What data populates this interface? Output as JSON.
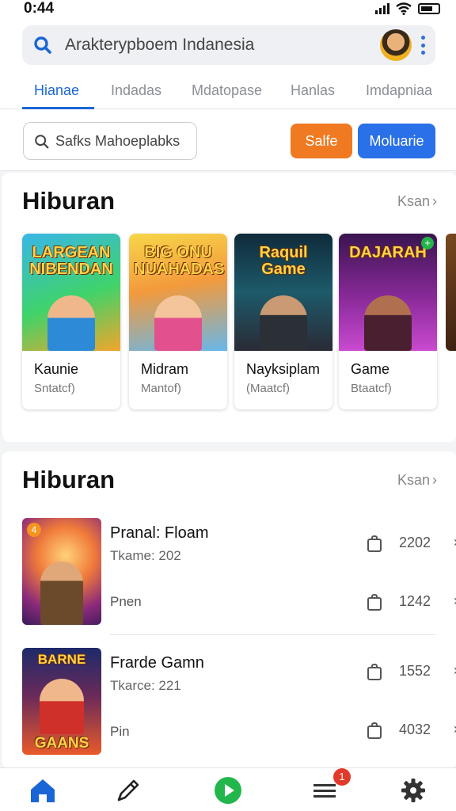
{
  "status_bar": {
    "time": "0:44"
  },
  "search": {
    "text": "Arakterypboem Indanesia"
  },
  "tabs": [
    {
      "label": "Hianae",
      "active": true
    },
    {
      "label": "Indadas",
      "active": false
    },
    {
      "label": "Mdatopase",
      "active": false
    },
    {
      "label": "Hanlas",
      "active": false
    },
    {
      "label": "Imdapniaa",
      "active": false
    }
  ],
  "filter": {
    "placeholder": "Safks Mahoeplabks",
    "orange_button": "Salfe",
    "blue_button": "Moluarie"
  },
  "colors": {
    "accent_blue": "#1a66d6",
    "orange": "#f07a22",
    "button_blue": "#2a70e8",
    "badge_red": "#e23a2a"
  },
  "section1": {
    "title": "Hiburan",
    "see_all": "Ksan",
    "cards": [
      {
        "art_title": "LARGEAN NIBENDAN",
        "name": "Kaunie",
        "sub": "Sntatcf)"
      },
      {
        "art_title": "BIG ONU NUAHADAS",
        "name": "Midram",
        "sub": "Mantof)"
      },
      {
        "art_title": "Raquil Game",
        "name": "Nayksiplam",
        "sub": "(Maatcf)"
      },
      {
        "art_title": "DAJARAH",
        "name": "Game",
        "sub": "Btaatcf)"
      }
    ]
  },
  "section2": {
    "title": "Hiburan",
    "see_all": "Ksan",
    "rows": [
      {
        "title": "Pranal: Floam",
        "sub": "Tkame: 202",
        "extra": "Pnen",
        "badge": "4",
        "price_top": "2202",
        "price_bottom": "1242"
      },
      {
        "title": "Frarde Gamn",
        "sub": "Tkarce: 221",
        "extra": "Pin",
        "art_title_top": "BARNE",
        "art_title_bottom": "GAANS",
        "price_top": "1552",
        "price_bottom": "4032"
      }
    ]
  },
  "bottom_nav": {
    "notification_count": "1",
    "items": [
      {
        "icon": "home-icon",
        "active": true
      },
      {
        "icon": "pen-icon",
        "active": false
      },
      {
        "icon": "play-icon",
        "active": false
      },
      {
        "icon": "list-icon",
        "active": false
      },
      {
        "icon": "gear-icon",
        "active": false
      }
    ]
  }
}
